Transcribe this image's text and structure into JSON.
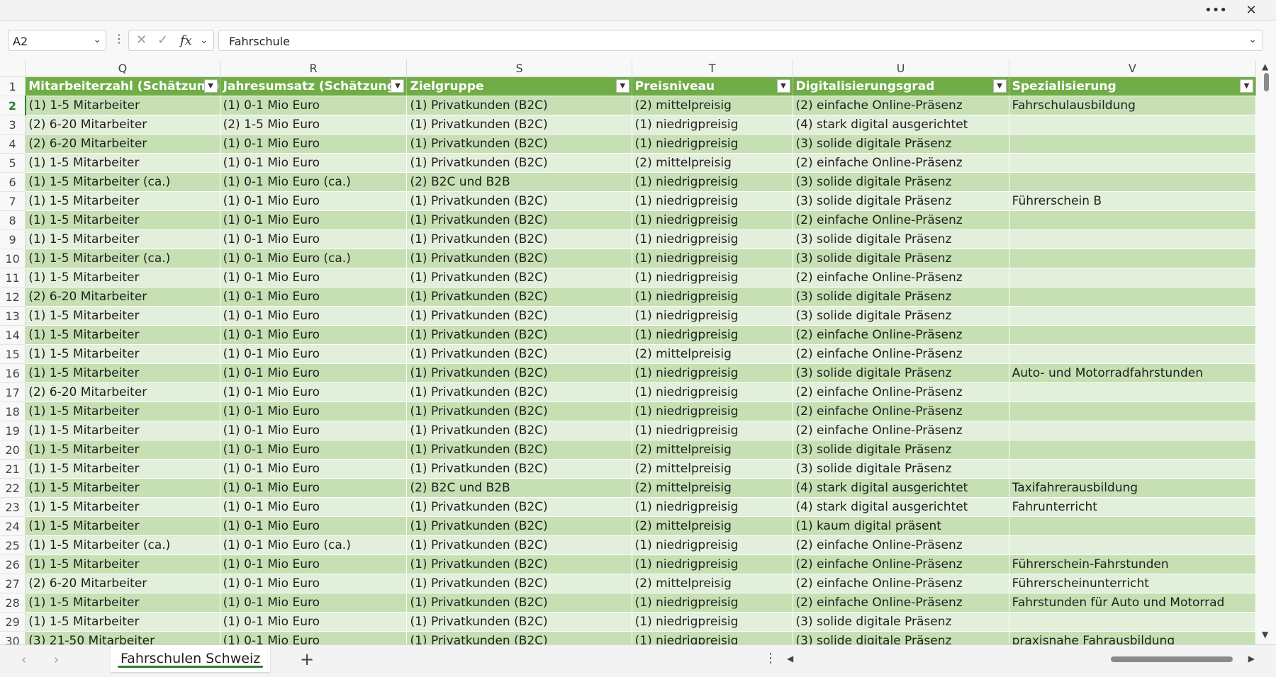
{
  "window": {
    "more_label": "•••",
    "close_label": "✕"
  },
  "formula_bar": {
    "name_box": "A2",
    "cancel_symbol": "✕",
    "enter_symbol": "✓",
    "fx_label": "fx",
    "value": "Fahrschule"
  },
  "columns": [
    "Q",
    "R",
    "S",
    "T",
    "U",
    "V"
  ],
  "headers": [
    "Mitarbeiterzahl (Schätzung)",
    "Jahresumsatz (Schätzung)",
    "Zielgruppe",
    "Preisniveau",
    "Digitalisierungsgrad",
    "Spezialisierung"
  ],
  "rows": [
    {
      "n": "2",
      "cells": [
        "(1) 1-5 Mitarbeiter",
        "(1) 0-1 Mio Euro",
        "(1) Privatkunden (B2C)",
        "(2) mittelpreisig",
        "(2) einfache Online-Präsenz",
        "Fahrschulausbildung"
      ]
    },
    {
      "n": "3",
      "cells": [
        "(2) 6-20 Mitarbeiter",
        "(2) 1-5 Mio Euro",
        "(1) Privatkunden (B2C)",
        "(1) niedrigpreisig",
        "(4) stark digital ausgerichtet",
        ""
      ]
    },
    {
      "n": "4",
      "cells": [
        "(2) 6-20 Mitarbeiter",
        "(1) 0-1 Mio Euro",
        "(1) Privatkunden (B2C)",
        "(1) niedrigpreisig",
        "(3) solide digitale Präsenz",
        ""
      ]
    },
    {
      "n": "5",
      "cells": [
        "(1) 1-5 Mitarbeiter",
        "(1) 0-1 Mio Euro",
        "(1) Privatkunden (B2C)",
        "(2) mittelpreisig",
        "(2) einfache Online-Präsenz",
        ""
      ]
    },
    {
      "n": "6",
      "cells": [
        "(1) 1-5 Mitarbeiter (ca.)",
        "(1) 0-1 Mio Euro (ca.)",
        "(2) B2C und B2B",
        "(1) niedrigpreisig",
        "(3) solide digitale Präsenz",
        ""
      ]
    },
    {
      "n": "7",
      "cells": [
        "(1) 1-5 Mitarbeiter",
        "(1) 0-1 Mio Euro",
        "(1) Privatkunden (B2C)",
        "(1) niedrigpreisig",
        "(3) solide digitale Präsenz",
        "Führerschein B"
      ]
    },
    {
      "n": "8",
      "cells": [
        "(1) 1-5 Mitarbeiter",
        "(1) 0-1 Mio Euro",
        "(1) Privatkunden (B2C)",
        "(1) niedrigpreisig",
        "(2) einfache Online-Präsenz",
        ""
      ]
    },
    {
      "n": "9",
      "cells": [
        "(1) 1-5 Mitarbeiter",
        "(1) 0-1 Mio Euro",
        "(1) Privatkunden (B2C)",
        "(1) niedrigpreisig",
        "(3) solide digitale Präsenz",
        ""
      ]
    },
    {
      "n": "10",
      "cells": [
        "(1) 1-5 Mitarbeiter (ca.)",
        "(1) 0-1 Mio Euro (ca.)",
        "(1) Privatkunden (B2C)",
        "(1) niedrigpreisig",
        "(3) solide digitale Präsenz",
        ""
      ]
    },
    {
      "n": "11",
      "cells": [
        "(1) 1-5 Mitarbeiter",
        "(1) 0-1 Mio Euro",
        "(1) Privatkunden (B2C)",
        "(1) niedrigpreisig",
        "(2) einfache Online-Präsenz",
        ""
      ]
    },
    {
      "n": "12",
      "cells": [
        "(2) 6-20 Mitarbeiter",
        "(1) 0-1 Mio Euro",
        "(1) Privatkunden (B2C)",
        "(1) niedrigpreisig",
        "(3) solide digitale Präsenz",
        ""
      ]
    },
    {
      "n": "13",
      "cells": [
        "(1) 1-5 Mitarbeiter",
        "(1) 0-1 Mio Euro",
        "(1) Privatkunden (B2C)",
        "(1) niedrigpreisig",
        "(3) solide digitale Präsenz",
        ""
      ]
    },
    {
      "n": "14",
      "cells": [
        "(1) 1-5 Mitarbeiter",
        "(1) 0-1 Mio Euro",
        "(1) Privatkunden (B2C)",
        "(1) niedrigpreisig",
        "(2) einfache Online-Präsenz",
        ""
      ]
    },
    {
      "n": "15",
      "cells": [
        "(1) 1-5 Mitarbeiter",
        "(1) 0-1 Mio Euro",
        "(1) Privatkunden (B2C)",
        "(2) mittelpreisig",
        "(2) einfache Online-Präsenz",
        ""
      ]
    },
    {
      "n": "16",
      "cells": [
        "(1) 1-5 Mitarbeiter",
        "(1) 0-1 Mio Euro",
        "(1) Privatkunden (B2C)",
        "(1) niedrigpreisig",
        "(3) solide digitale Präsenz",
        "Auto- und Motorradfahrstunden"
      ]
    },
    {
      "n": "17",
      "cells": [
        "(2) 6-20 Mitarbeiter",
        "(1) 0-1 Mio Euro",
        "(1) Privatkunden (B2C)",
        "(1) niedrigpreisig",
        "(2) einfache Online-Präsenz",
        ""
      ]
    },
    {
      "n": "18",
      "cells": [
        "(1) 1-5 Mitarbeiter",
        "(1) 0-1 Mio Euro",
        "(1) Privatkunden (B2C)",
        "(1) niedrigpreisig",
        "(2) einfache Online-Präsenz",
        ""
      ]
    },
    {
      "n": "19",
      "cells": [
        "(1) 1-5 Mitarbeiter",
        "(1) 0-1 Mio Euro",
        "(1) Privatkunden (B2C)",
        "(1) niedrigpreisig",
        "(2) einfache Online-Präsenz",
        ""
      ]
    },
    {
      "n": "20",
      "cells": [
        "(1) 1-5 Mitarbeiter",
        "(1) 0-1 Mio Euro",
        "(1) Privatkunden (B2C)",
        "(2) mittelpreisig",
        "(3) solide digitale Präsenz",
        ""
      ]
    },
    {
      "n": "21",
      "cells": [
        "(1) 1-5 Mitarbeiter",
        "(1) 0-1 Mio Euro",
        "(1) Privatkunden (B2C)",
        "(2) mittelpreisig",
        "(3) solide digitale Präsenz",
        ""
      ]
    },
    {
      "n": "22",
      "cells": [
        "(1) 1-5 Mitarbeiter",
        "(1) 0-1 Mio Euro",
        "(2) B2C und B2B",
        "(2) mittelpreisig",
        "(4) stark digital ausgerichtet",
        "Taxifahrerausbildung"
      ]
    },
    {
      "n": "23",
      "cells": [
        "(1) 1-5 Mitarbeiter",
        "(1) 0-1 Mio Euro",
        "(1) Privatkunden (B2C)",
        "(1) niedrigpreisig",
        "(4) stark digital ausgerichtet",
        "Fahrunterricht"
      ]
    },
    {
      "n": "24",
      "cells": [
        "(1) 1-5 Mitarbeiter",
        "(1) 0-1 Mio Euro",
        "(1) Privatkunden (B2C)",
        "(2) mittelpreisig",
        "(1) kaum digital präsent",
        ""
      ]
    },
    {
      "n": "25",
      "cells": [
        "(1) 1-5 Mitarbeiter (ca.)",
        "(1) 0-1 Mio Euro (ca.)",
        "(1) Privatkunden (B2C)",
        "(1) niedrigpreisig",
        "(2) einfache Online-Präsenz",
        ""
      ]
    },
    {
      "n": "26",
      "cells": [
        "(1) 1-5 Mitarbeiter",
        "(1) 0-1 Mio Euro",
        "(1) Privatkunden (B2C)",
        "(1) niedrigpreisig",
        "(2) einfache Online-Präsenz",
        "Führerschein-Fahrstunden"
      ]
    },
    {
      "n": "27",
      "cells": [
        "(2) 6-20 Mitarbeiter",
        "(1) 0-1 Mio Euro",
        "(1) Privatkunden (B2C)",
        "(2) mittelpreisig",
        "(2) einfache Online-Präsenz",
        "Führerscheinunterricht"
      ]
    },
    {
      "n": "28",
      "cells": [
        "(1) 1-5 Mitarbeiter",
        "(1) 0-1 Mio Euro",
        "(1) Privatkunden (B2C)",
        "(1) niedrigpreisig",
        "(2) einfache Online-Präsenz",
        "Fahrstunden für Auto und Motorrad"
      ]
    },
    {
      "n": "29",
      "cells": [
        "(1) 1-5 Mitarbeiter",
        "(1) 0-1 Mio Euro",
        "(1) Privatkunden (B2C)",
        "(1) niedrigpreisig",
        "(3) solide digitale Präsenz",
        ""
      ]
    },
    {
      "n": "30",
      "cells": [
        "(3) 21-50 Mitarbeiter",
        "(1) 0-1 Mio Euro",
        "(1) Privatkunden (B2C)",
        "(1) niedrigpreisig",
        "(3) solide digitale Präsenz",
        "praxisnahe Fahrausbildung"
      ]
    }
  ],
  "sheet": {
    "tab_name": "Fahrschulen Schweiz",
    "add_label": "+",
    "more_label": "⋮"
  },
  "colors": {
    "header_green": "#70ad47",
    "band_dark": "#c6e0b4",
    "band_light": "#e2efda",
    "accent": "#2f7d32"
  },
  "icons": {
    "namebox_dropdown": "chevron-down-icon",
    "formula_expand": "chevron-down-icon",
    "filter": "filter-dropdown-icon"
  }
}
